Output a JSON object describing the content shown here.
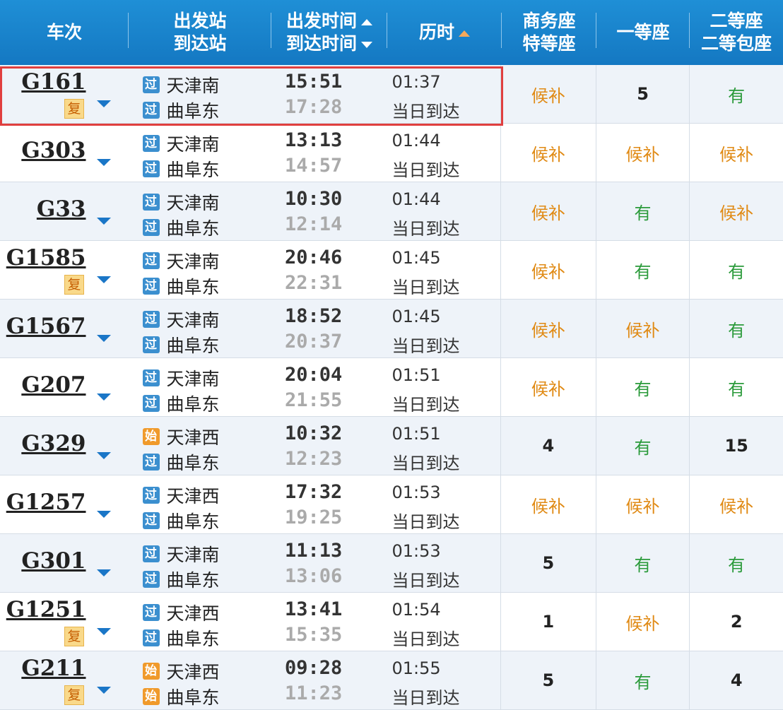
{
  "header": {
    "train": "车次",
    "station_dep": "出发站",
    "station_arr": "到达站",
    "time_dep": "出发时间",
    "time_arr": "到达时间",
    "duration": "历时",
    "business": "商务座",
    "special": "特等座",
    "first": "一等座",
    "second": "二等座",
    "second_box": "二等包座"
  },
  "badges": {
    "pass": "过",
    "start": "始",
    "fu": "复"
  },
  "colors": {
    "header": "#1478c2",
    "waitlist": "#e08a14",
    "available": "#2a9a3a",
    "highlight": "#e03f3f",
    "link": "#1a76c7"
  },
  "rows": [
    {
      "train": "G161",
      "fu": true,
      "from_type": "pass",
      "from": "天津南",
      "to_type": "pass",
      "to": "曲阜东",
      "dep": "15:51",
      "arr": "17:28",
      "dur": "01:37",
      "arrive": "当日到达",
      "b": "候补",
      "f": "5",
      "s": "有"
    },
    {
      "train": "G303",
      "fu": false,
      "from_type": "pass",
      "from": "天津南",
      "to_type": "pass",
      "to": "曲阜东",
      "dep": "13:13",
      "arr": "14:57",
      "dur": "01:44",
      "arrive": "当日到达",
      "b": "候补",
      "f": "候补",
      "s": "候补"
    },
    {
      "train": "G33",
      "fu": false,
      "from_type": "pass",
      "from": "天津南",
      "to_type": "pass",
      "to": "曲阜东",
      "dep": "10:30",
      "arr": "12:14",
      "dur": "01:44",
      "arrive": "当日到达",
      "b": "候补",
      "f": "有",
      "s": "候补"
    },
    {
      "train": "G1585",
      "fu": true,
      "from_type": "pass",
      "from": "天津南",
      "to_type": "pass",
      "to": "曲阜东",
      "dep": "20:46",
      "arr": "22:31",
      "dur": "01:45",
      "arrive": "当日到达",
      "b": "候补",
      "f": "有",
      "s": "有"
    },
    {
      "train": "G1567",
      "fu": false,
      "from_type": "pass",
      "from": "天津南",
      "to_type": "pass",
      "to": "曲阜东",
      "dep": "18:52",
      "arr": "20:37",
      "dur": "01:45",
      "arrive": "当日到达",
      "b": "候补",
      "f": "候补",
      "s": "有"
    },
    {
      "train": "G207",
      "fu": false,
      "from_type": "pass",
      "from": "天津南",
      "to_type": "pass",
      "to": "曲阜东",
      "dep": "20:04",
      "arr": "21:55",
      "dur": "01:51",
      "arrive": "当日到达",
      "b": "候补",
      "f": "有",
      "s": "有"
    },
    {
      "train": "G329",
      "fu": false,
      "from_type": "start",
      "from": "天津西",
      "to_type": "pass",
      "to": "曲阜东",
      "dep": "10:32",
      "arr": "12:23",
      "dur": "01:51",
      "arrive": "当日到达",
      "b": "4",
      "f": "有",
      "s": "15"
    },
    {
      "train": "G1257",
      "fu": false,
      "from_type": "pass",
      "from": "天津西",
      "to_type": "pass",
      "to": "曲阜东",
      "dep": "17:32",
      "arr": "19:25",
      "dur": "01:53",
      "arrive": "当日到达",
      "b": "候补",
      "f": "候补",
      "s": "候补"
    },
    {
      "train": "G301",
      "fu": false,
      "from_type": "pass",
      "from": "天津南",
      "to_type": "pass",
      "to": "曲阜东",
      "dep": "11:13",
      "arr": "13:06",
      "dur": "01:53",
      "arrive": "当日到达",
      "b": "5",
      "f": "有",
      "s": "有"
    },
    {
      "train": "G1251",
      "fu": true,
      "from_type": "pass",
      "from": "天津西",
      "to_type": "pass",
      "to": "曲阜东",
      "dep": "13:41",
      "arr": "15:35",
      "dur": "01:54",
      "arrive": "当日到达",
      "b": "1",
      "f": "候补",
      "s": "2"
    },
    {
      "train": "G211",
      "fu": true,
      "from_type": "start",
      "from": "天津西",
      "to_type": "start",
      "to": "曲阜东",
      "dep": "09:28",
      "arr": "11:23",
      "dur": "01:55",
      "arrive": "当日到达",
      "b": "5",
      "f": "有",
      "s": "4"
    }
  ]
}
